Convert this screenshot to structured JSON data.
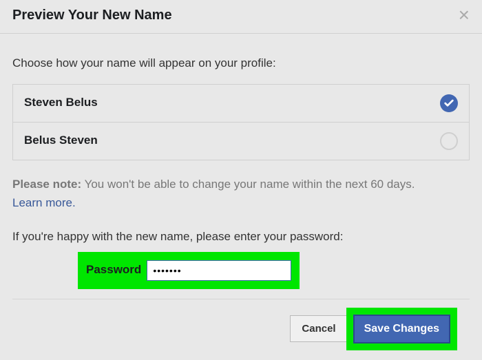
{
  "dialog": {
    "title": "Preview Your New Name",
    "instruction": "Choose how your name will appear on your profile:",
    "options": [
      {
        "label": "Steven Belus",
        "selected": true
      },
      {
        "label": "Belus Steven",
        "selected": false
      }
    ],
    "note_bold": "Please note:",
    "note_text": " You won't be able to change your name within the next 60 days.",
    "learn_more": "Learn more",
    "happy_text": "If you're happy with the new name, please enter your password:",
    "password_label": "Password",
    "password_value": "•••••••",
    "cancel_label": "Cancel",
    "save_label": "Save Changes"
  }
}
